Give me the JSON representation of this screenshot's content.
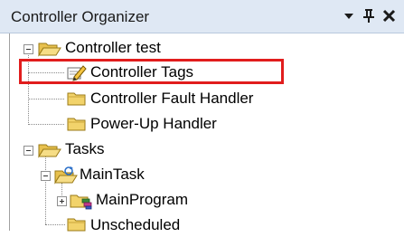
{
  "window": {
    "title": "Controller Organizer",
    "controls": {
      "dropdown": "▼",
      "pin": "pin",
      "close": "✕"
    }
  },
  "tree": {
    "controller": {
      "label": "Controller test",
      "expanded": true
    },
    "controller_tags": {
      "label": "Controller Tags",
      "highlighted": true
    },
    "fault_handler": {
      "label": "Controller Fault Handler"
    },
    "powerup_handler": {
      "label": "Power-Up Handler"
    },
    "tasks": {
      "label": "Tasks",
      "expanded": true
    },
    "main_task": {
      "label": "MainTask",
      "expanded": true
    },
    "main_program": {
      "label": "MainProgram",
      "expanded": false
    },
    "unscheduled": {
      "label": "Unscheduled"
    }
  },
  "colors": {
    "titlebar": "#dfe8f4",
    "highlight": "#e11d1d",
    "folder": "#f2d36b"
  },
  "icons": {
    "controller": "folder-open-icon",
    "controller_tags": "tags-pencil-icon",
    "fault_handler": "folder-icon",
    "powerup_handler": "folder-icon",
    "tasks": "folder-open-icon",
    "main_task": "task-cycle-icon",
    "main_program": "program-folder-icon",
    "unscheduled": "folder-icon"
  }
}
